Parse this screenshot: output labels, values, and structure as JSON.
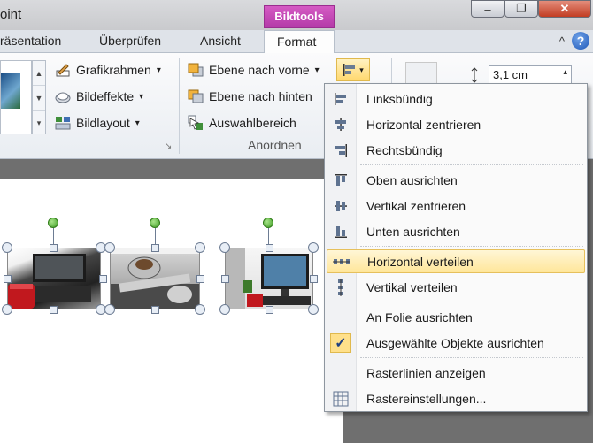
{
  "title_bar": {
    "app_title": "oint",
    "context_tab": "Bildtools",
    "window_buttons": {
      "minimize": "–",
      "restore": "❐",
      "close": "✕"
    }
  },
  "tabs": [
    {
      "label": "räsentation"
    },
    {
      "label": "Überprüfen"
    },
    {
      "label": "Ansicht"
    },
    {
      "label": "Format"
    }
  ],
  "tab_icons": {
    "collapse": "^",
    "help": "?"
  },
  "ribbon": {
    "picture_styles": {
      "items": [
        {
          "label": "Grafikrahmen",
          "icon": "picture-border-icon"
        },
        {
          "label": "Bildeffekte",
          "icon": "picture-effects-icon"
        },
        {
          "label": "Bildlayout",
          "icon": "picture-layout-icon"
        }
      ]
    },
    "arrange": {
      "label": "Anordnen",
      "items": [
        {
          "label": "Ebene nach vorne",
          "icon": "bring-forward-icon"
        },
        {
          "label": "Ebene nach hinten",
          "icon": "send-backward-icon"
        },
        {
          "label": "Auswahlbereich",
          "icon": "selection-pane-icon"
        }
      ],
      "align_button_icon": "align-icon"
    },
    "size": {
      "height_value": "3,1 cm"
    }
  },
  "align_menu": {
    "items": [
      {
        "label": "Linksbündig",
        "icon": "align-left-icon"
      },
      {
        "label": "Horizontal zentrieren",
        "icon": "align-center-icon"
      },
      {
        "label": "Rechtsbündig",
        "icon": "align-right-icon"
      },
      {
        "label": "Oben ausrichten",
        "icon": "align-top-icon"
      },
      {
        "label": "Vertikal zentrieren",
        "icon": "align-middle-icon"
      },
      {
        "label": "Unten ausrichten",
        "icon": "align-bottom-icon"
      },
      {
        "label": "Horizontal verteilen",
        "icon": "distribute-horizontal-icon",
        "highlighted": true
      },
      {
        "label": "Vertikal verteilen",
        "icon": "distribute-vertical-icon"
      },
      {
        "label": "An Folie ausrichten",
        "icon": ""
      },
      {
        "label": "Ausgewählte Objekte ausrichten",
        "icon": "checkmark-icon",
        "checked": true
      },
      {
        "label": "Rasterlinien anzeigen",
        "icon": ""
      },
      {
        "label": "Rastereinstellungen...",
        "icon": "grid-icon"
      }
    ]
  },
  "colors": {
    "context_tab": "#c34bb6",
    "highlight": "#ffe69a",
    "slide_bg": "#ffffff",
    "workspace": "#6f6f6f"
  }
}
